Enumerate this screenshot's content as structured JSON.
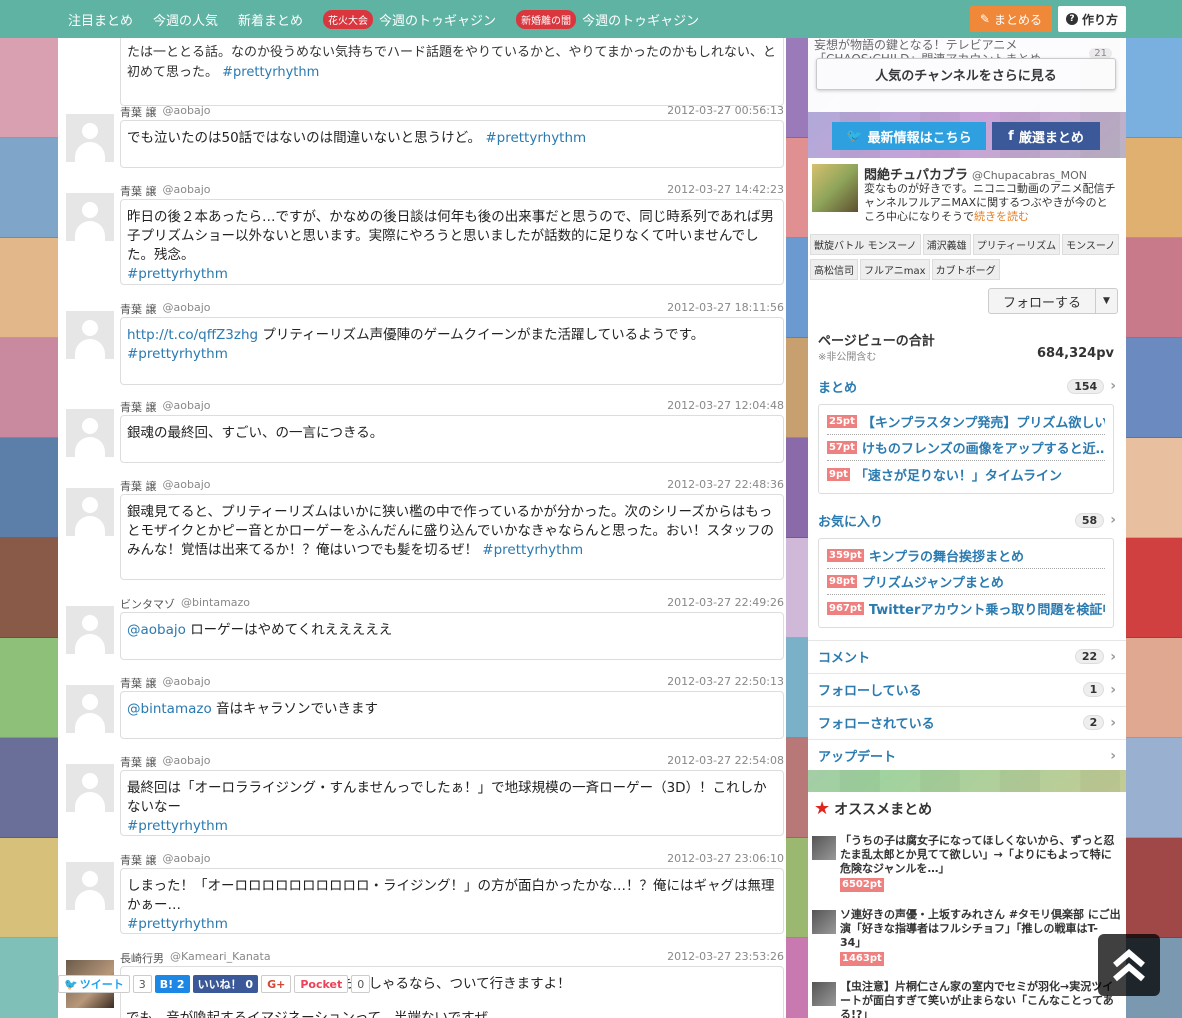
{
  "nav": {
    "items": [
      {
        "label": "注目まとめ"
      },
      {
        "label": "今週の人気"
      },
      {
        "label": "新着まとめ"
      },
      {
        "badge": "花火大会",
        "label": "今週のトゥギャジン"
      },
      {
        "badge": "新婚離の闇",
        "label": "今週のトゥギャジン"
      }
    ],
    "matome_label": "まとめる",
    "howto_label": "作り方"
  },
  "first_bubble": {
    "text": "たは一ととる話。なのか役うめない気持ちでハード話題をやりているかと、やりてまかったのかもしれない、と初めて思った。",
    "hashtag": "#prettyrhythm"
  },
  "tweets": [
    {
      "name": "青葉 譲",
      "handle": "@aobajo",
      "date": "2012-03-27 00:56:13",
      "text": "でも泣いたのは50話ではないのは間違いないと思うけど。",
      "hashtag": "#prettyrhythm"
    },
    {
      "name": "青葉 譲",
      "handle": "@aobajo",
      "date": "2012-03-27 14:42:23",
      "text": "昨日の後２本あったら…ですが、かなめの後日談は何年も後の出来事だと思うので、同じ時系列であれば男子プリズムショー以外ないと思います。実際にやろうと思いましたが話数的に足りなくて叶いませんでした。残念。",
      "hashtag": "#prettyrhythm"
    },
    {
      "name": "青葉 譲",
      "handle": "@aobajo",
      "date": "2012-03-27 18:11:56",
      "link": "http://t.co/qffZ3zhg",
      "text": "プリティーリズム声優陣のゲームクイーンがまた活躍しているようです。",
      "hashtag": "#prettyrhythm"
    },
    {
      "name": "青葉 譲",
      "handle": "@aobajo",
      "date": "2012-03-27 12:04:48",
      "text": "銀魂の最終回、すごい、の一言につきる。"
    },
    {
      "name": "青葉 譲",
      "handle": "@aobajo",
      "date": "2012-03-27 22:48:36",
      "text": "銀魂見てると、プリティーリズムはいかに狭い檻の中で作っているかが分かった。次のシリーズからはもっとモザイクとかピー音とかローゲーをふんだんに盛り込んでいかなきゃならんと思った。おい！スタッフのみんな！覚悟は出来てるか！？俺はいつでも髪を切るぜ！",
      "hashtag": "#prettyrhythm"
    },
    {
      "name": "ビンタマゾ",
      "handle": "@bintamazo",
      "date": "2012-03-27 22:49:26",
      "mention": "@aobajo",
      "text": "ローゲーはやめてくれえええええ"
    },
    {
      "name": "青葉 譲",
      "handle": "@aobajo",
      "date": "2012-03-27 22:50:13",
      "mention": "@bintamazo",
      "text": "音はキャラソンでいきます"
    },
    {
      "name": "青葉 譲",
      "handle": "@aobajo",
      "date": "2012-03-27 22:54:08",
      "text": "最終回は「オーロラライジング・すんませんっでしたぁ！」で地球規模の一斉ローゲー（3D）！これしかないなー",
      "hashtag": "#prettyrhythm"
    },
    {
      "name": "青葉 譲",
      "handle": "@aobajo",
      "date": "2012-03-27 23:06:10",
      "text": "しまった！「オーロロロロロロロロロロ・ライジング！」の方が面白かったかな…！？俺にはギャグは無理かぁー…",
      "hashtag": "#prettyrhythm"
    },
    {
      "name": "長崎行男",
      "handle": "@Kameari_Kanata",
      "date": "2012-03-27 23:53:26",
      "text": "がそうおっしゃるなら、ついて行きますよ！",
      "text2": "でも、音が喚起するイマジネーションって、半端ないですぜ。"
    }
  ],
  "sharebar": {
    "tweet": "ツイート",
    "tweet_count": "3",
    "hatena": "B! 2",
    "like": "いいね！ 0",
    "gplus": "G+",
    "pocket": "Pocket",
    "pocket_count": "0"
  },
  "sidebar": {
    "top_text": "妄想が物語の鍵となる！テレビアニメ「CHAOS;CHILD」関連アカウントまとめ",
    "top_count": "21",
    "more_channels": "人気のチャンネルをさらに見る",
    "info_btn": "最新情報はこちら",
    "best_btn": "厳選まとめ",
    "profile": {
      "name": "悶絶チュパカブラ",
      "handle": "@Chupacabras_MON",
      "desc": "変なものが好きです。ニコニコ動画のアニメ配信チャンネルフルアニMAXに関するつぶやきが今のところ中心になりそうで",
      "read_more": "続きを読む",
      "tags": [
        "獣旋バトル モンスーノ",
        "浦沢義雄",
        "プリティーリズム",
        "モンスーノ",
        "高松信司",
        "フルアニmax",
        "カブトボーグ"
      ],
      "follow": "フォローする"
    },
    "pv": {
      "title": "ページビューの合計",
      "note": "※非公開含む",
      "value": "684,324pv"
    },
    "matome": {
      "label": "まとめ",
      "count": "154",
      "items": [
        {
          "pt": "25pt",
          "title": "【キンプラスタンプ発売】プリズム欲しい…"
        },
        {
          "pt": "57pt",
          "title": "けものフレンズの画像をアップすると近…"
        },
        {
          "pt": "9pt",
          "title": "「速さが足りない！」タイムライン"
        }
      ]
    },
    "favorites": {
      "label": "お気に入り",
      "count": "58",
      "items": [
        {
          "pt": "359pt",
          "title": "キンプラの舞台挨拶まとめ"
        },
        {
          "pt": "98pt",
          "title": "プリズムジャンプまとめ"
        },
        {
          "pt": "967pt",
          "title": "Twitterアカウント乗っ取り問題を検証中"
        }
      ]
    },
    "links": [
      {
        "label": "コメント",
        "count": "22"
      },
      {
        "label": "フォローしている",
        "count": "1"
      },
      {
        "label": "フォローされている",
        "count": "2"
      },
      {
        "label": "アップデート"
      }
    ],
    "reco": {
      "title": "オススメまとめ",
      "items": [
        {
          "title": "「うちの子は腐女子になってほしくないから、ずっと忍たま乱太郎とか見てて欲しい」→「よりにもよって特に危険なジャンルを…」",
          "pt": "6502pt"
        },
        {
          "title": "ソ連好きの声優・上坂すみれさん #タモリ倶楽部 にご出演「好きな指導者はフルシチョフ」「推しの戦車はT-34」",
          "pt": "1463pt"
        },
        {
          "title": "【虫注意】片桐仁さん家の室内でセミが羽化→実況ツイートが面白すぎて笑いが止まらない「こんなことってある!?」",
          "pt": ""
        }
      ]
    }
  },
  "colors": {
    "nav_bg": "#5fb3a3",
    "accent": "#f0883a",
    "link": "#2a7ab0",
    "pt_badge": "#ef8080"
  }
}
